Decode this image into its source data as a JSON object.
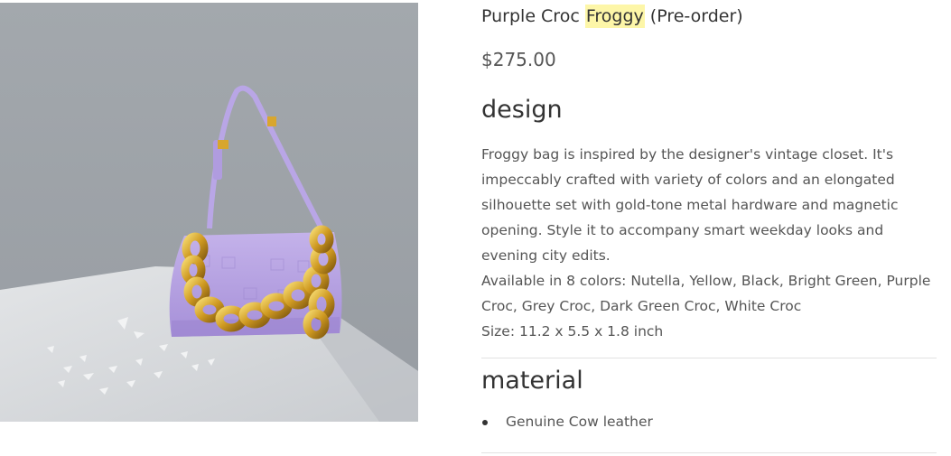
{
  "product": {
    "title_before": "Purple Croc ",
    "title_highlight": "Froggy",
    "title_after": " (Pre-order)",
    "price": "$275.00",
    "image_alt": "Purple croc Froggy bag with gold chain"
  },
  "design": {
    "heading": "design",
    "description": "Froggy bag is inspired by the designer's vintage closet. It's impeccably crafted with variety of colors and an elongated silhouette set with gold-tone metal hardware and magnetic opening. Style it to accompany smart weekday looks and evening city edits.",
    "colors": "Available in 8 colors: Nutella, Yellow, Black, Bright Green, Purple Croc, Grey Croc, Dark Green Croc, White Croc",
    "size": "Size: 11.2 x 5.5 x 1.8 inch"
  },
  "material": {
    "heading": "material",
    "items": [
      "Genuine Cow leather"
    ]
  },
  "colors": {
    "highlight": "#fdf6a8",
    "bag": "#b7a3e0",
    "chain": "#d9a82c",
    "backdrop": "#9ea3a8"
  }
}
